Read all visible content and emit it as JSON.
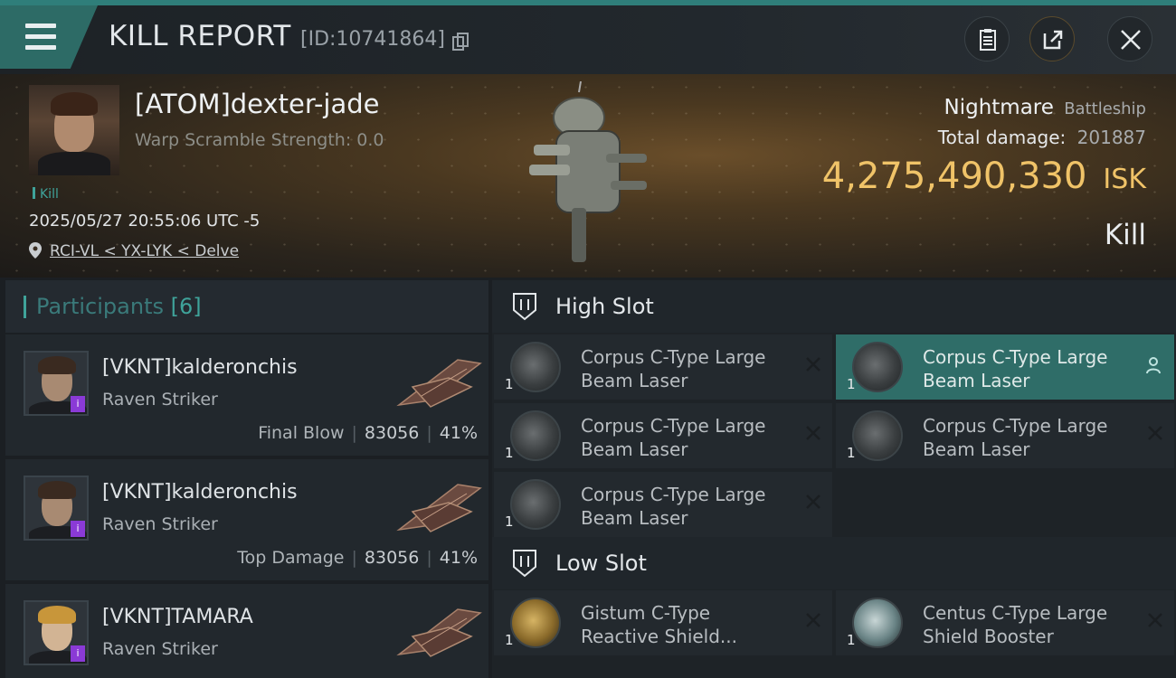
{
  "header": {
    "title": "KILL REPORT",
    "kill_id": "[ID:10741864]"
  },
  "victim": {
    "name": "[ATOM]dexter-jade",
    "warp_scramble": "Warp Scramble Strength: 0.0",
    "tag": "Kill",
    "datetime": "2025/05/27 20:55:06 UTC -5",
    "location": "RCI-VL < YX-LYK < Delve",
    "ship_name": "Nightmare",
    "ship_class": "Battleship",
    "damage_label": "Total damage:",
    "damage_value": "201887",
    "isk_value": "4,275,490,330",
    "isk_unit": "ISK",
    "result": "Kill"
  },
  "participants": {
    "label": "Participants",
    "count": "[6]",
    "rows": [
      {
        "name": "[VKNT]kalderonchis",
        "ship": "Raven Striker",
        "role": "Final Blow",
        "damage": "83056",
        "percent": "41%",
        "badge": "i"
      },
      {
        "name": "[VKNT]kalderonchis",
        "ship": "Raven Striker",
        "role": "Top Damage",
        "damage": "83056",
        "percent": "41%",
        "badge": "i"
      },
      {
        "name": "[VKNT]TAMARA",
        "ship": "Raven Striker",
        "badge": "i"
      }
    ]
  },
  "slots": {
    "high": {
      "label": "High Slot",
      "modules": [
        {
          "name": "Corpus C-Type Large Beam Laser",
          "qty": "1"
        },
        {
          "name": "Corpus C-Type Large Beam Laser",
          "qty": "1"
        },
        {
          "name": "Corpus C-Type Large Beam Laser",
          "qty": "1"
        },
        {
          "name": "Corpus C-Type Large Beam Laser",
          "qty": "1"
        },
        {
          "name": "Corpus C-Type Large Beam Laser",
          "qty": "1"
        }
      ]
    },
    "low": {
      "label": "Low Slot",
      "modules": [
        {
          "name": "Gistum C-Type Reactive Shield...",
          "qty": "1"
        },
        {
          "name": "Centus C-Type Large Shield Booster",
          "qty": "1"
        }
      ]
    }
  },
  "colors": {
    "accent": "#3fa39a",
    "isk": "#f0c368",
    "selected_row": "#2f6d68"
  }
}
